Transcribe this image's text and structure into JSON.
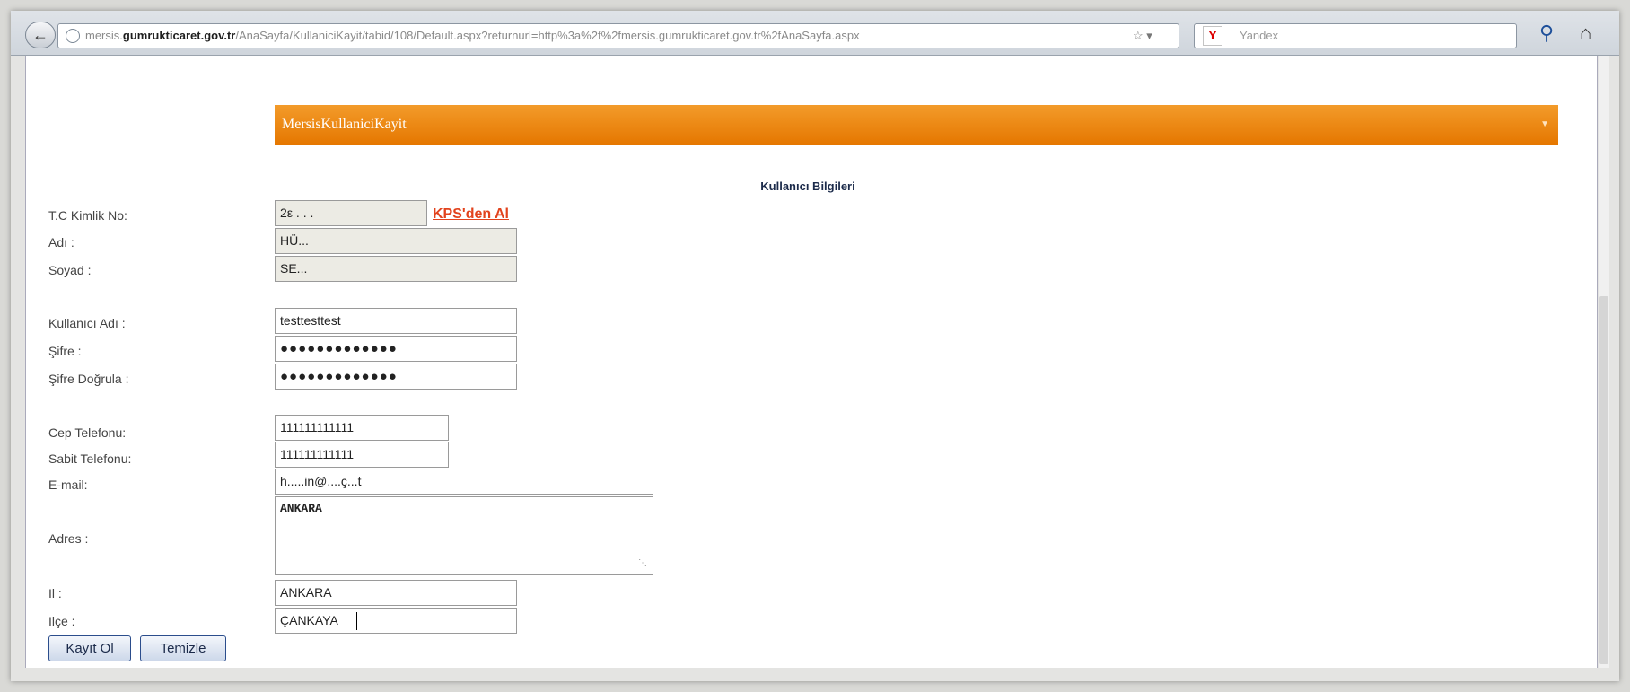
{
  "browser": {
    "url_prefix": "mersis.",
    "url_domain": "gumrukticaret.gov.tr",
    "url_path": "/AnaSayfa/KullaniciKayit/tabid/108/Default.aspx?returnurl=http%3a%2f%2fmersis.gumrukticaret.gov.tr%2fAnaSayfa.aspx",
    "url_icons": "☆ ▾",
    "search_placeholder": "Yandex",
    "search_engine_logo": "Y"
  },
  "module": {
    "title": "MersisKullaniciKayit"
  },
  "section_title": "Kullanıcı Bilgileri",
  "form": {
    "tc_label": "T.C Kimlik No:",
    "tc_value": "2ε . . .",
    "kps_link": "KPS'den Al",
    "name_label": "Adı :",
    "name_value": "HÜ...",
    "surname_label": "Soyad :",
    "surname_value": "SE...",
    "username_label": "Kullanıcı Adı :",
    "username_value": "testtesttest",
    "password_label": "Şifre :",
    "password_value": "●●●●●●●●●●●●●",
    "password_confirm_label": "Şifre Doğrula :",
    "password_confirm_value": "●●●●●●●●●●●●●",
    "mobile_label": "Cep Telefonu:",
    "mobile_value": "111111111111",
    "landline_label": "Sabit Telefonu:",
    "landline_value": "111111111111",
    "email_label": "E-mail:",
    "email_value": "h.....in@....ç...t",
    "address_label": "Adres :",
    "address_value": "ANKARA",
    "city_label": "Il :",
    "city_value": "ANKARA",
    "district_label": "Ilçe :",
    "district_value": "ÇANKAYA"
  },
  "buttons": {
    "register": "Kayıt Ol",
    "clear": "Temizle"
  },
  "colors": {
    "header_orange": "#ef8a12",
    "link_red": "#e2431d",
    "title_navy": "#1b2a4a"
  }
}
